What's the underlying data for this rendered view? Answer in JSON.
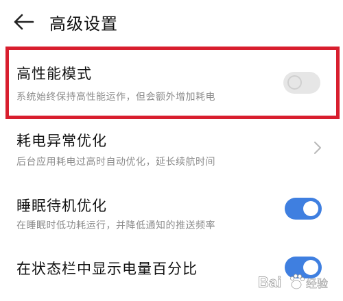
{
  "header": {
    "title": "高级设置"
  },
  "settings": [
    {
      "title": "高性能模式",
      "subtitle": "系统始终保持高性能运作，但会额外增加耗电",
      "control": "toggle",
      "state": "off"
    },
    {
      "title": "耗电异常优化",
      "subtitle": "后台应用耗电过高时自动优化，延长续航时间",
      "control": "chevron"
    },
    {
      "title": "睡眠待机优化",
      "subtitle": "在睡眠时低功耗运行，并降低通知的推送频率",
      "control": "toggle",
      "state": "on"
    },
    {
      "title": "在状态栏中显示电量百分比",
      "control": "toggle",
      "state": "on"
    }
  ],
  "colors": {
    "highlight": "#d81e2e",
    "accent": "#3f7fe0"
  },
  "watermark": {
    "brand": "Bai",
    "suffix": "经验",
    "icon": "baidu-paw-icon"
  }
}
